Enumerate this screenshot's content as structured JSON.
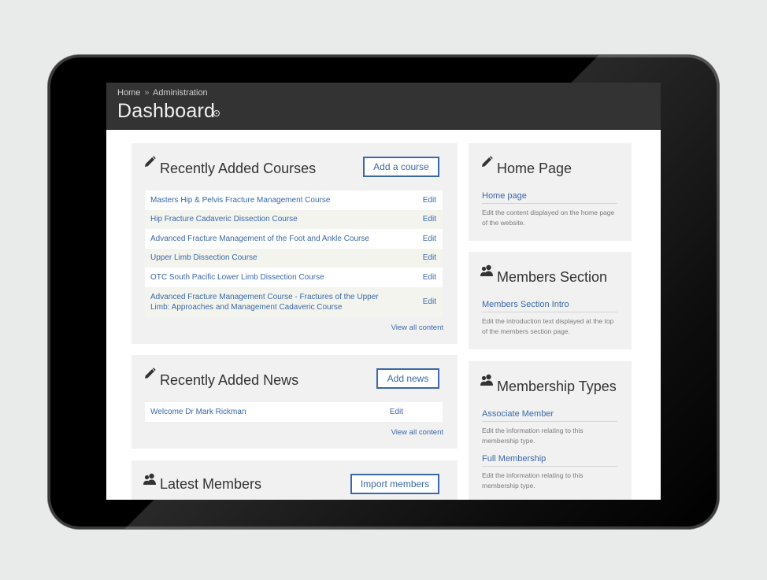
{
  "header": {
    "breadcrumb": [
      "Home",
      "Administration"
    ],
    "breadcrumb_sep": "»",
    "title": "Dashboard"
  },
  "courses": {
    "title": "Recently Added Courses",
    "button": "Add a course",
    "items": [
      {
        "title": "Masters Hip & Pelvis Fracture Management Course",
        "action": "Edit"
      },
      {
        "title": "Hip Fracture Cadaveric Dissection Course",
        "action": "Edit"
      },
      {
        "title": "Advanced Fracture Management of the Foot and Ankle Course",
        "action": "Edit"
      },
      {
        "title": "Upper Limb Dissection Course",
        "action": "Edit"
      },
      {
        "title": "OTC South Pacific Lower Limb Dissection Course",
        "action": "Edit"
      },
      {
        "title": "Advanced Fracture Management Course - Fractures of the Upper Limb: Approaches and Management Cadaveric Course",
        "action": "Edit"
      }
    ],
    "view_all": "View all content"
  },
  "news": {
    "title": "Recently Added News",
    "button": "Add news",
    "items": [
      {
        "title": "Welcome Dr Mark Rickman",
        "action": "Edit"
      }
    ],
    "view_all": "View all content"
  },
  "members": {
    "title": "Latest Members",
    "button": "Import members"
  },
  "home_page": {
    "title": "Home Page",
    "link": "Home page",
    "desc": "Edit the content displayed on the home page of the website."
  },
  "members_section": {
    "title": "Members Section",
    "link": "Members Section Intro",
    "desc": "Edit the introduction text displayed at the top of the members section page."
  },
  "membership_types": {
    "title": "Membership Types",
    "items": [
      {
        "link": "Associate Member",
        "desc": "Edit the information relating to this membership type."
      },
      {
        "link": "Full Membership",
        "desc": "Edit the information relating to this membership type."
      }
    ]
  },
  "icons": {
    "edit": "pencil-icon",
    "users": "users-icon",
    "settings": "settings-icon"
  },
  "colors": {
    "link": "#3a68a8",
    "header_bg": "#333333",
    "panel_bg": "#f1f1f1"
  }
}
